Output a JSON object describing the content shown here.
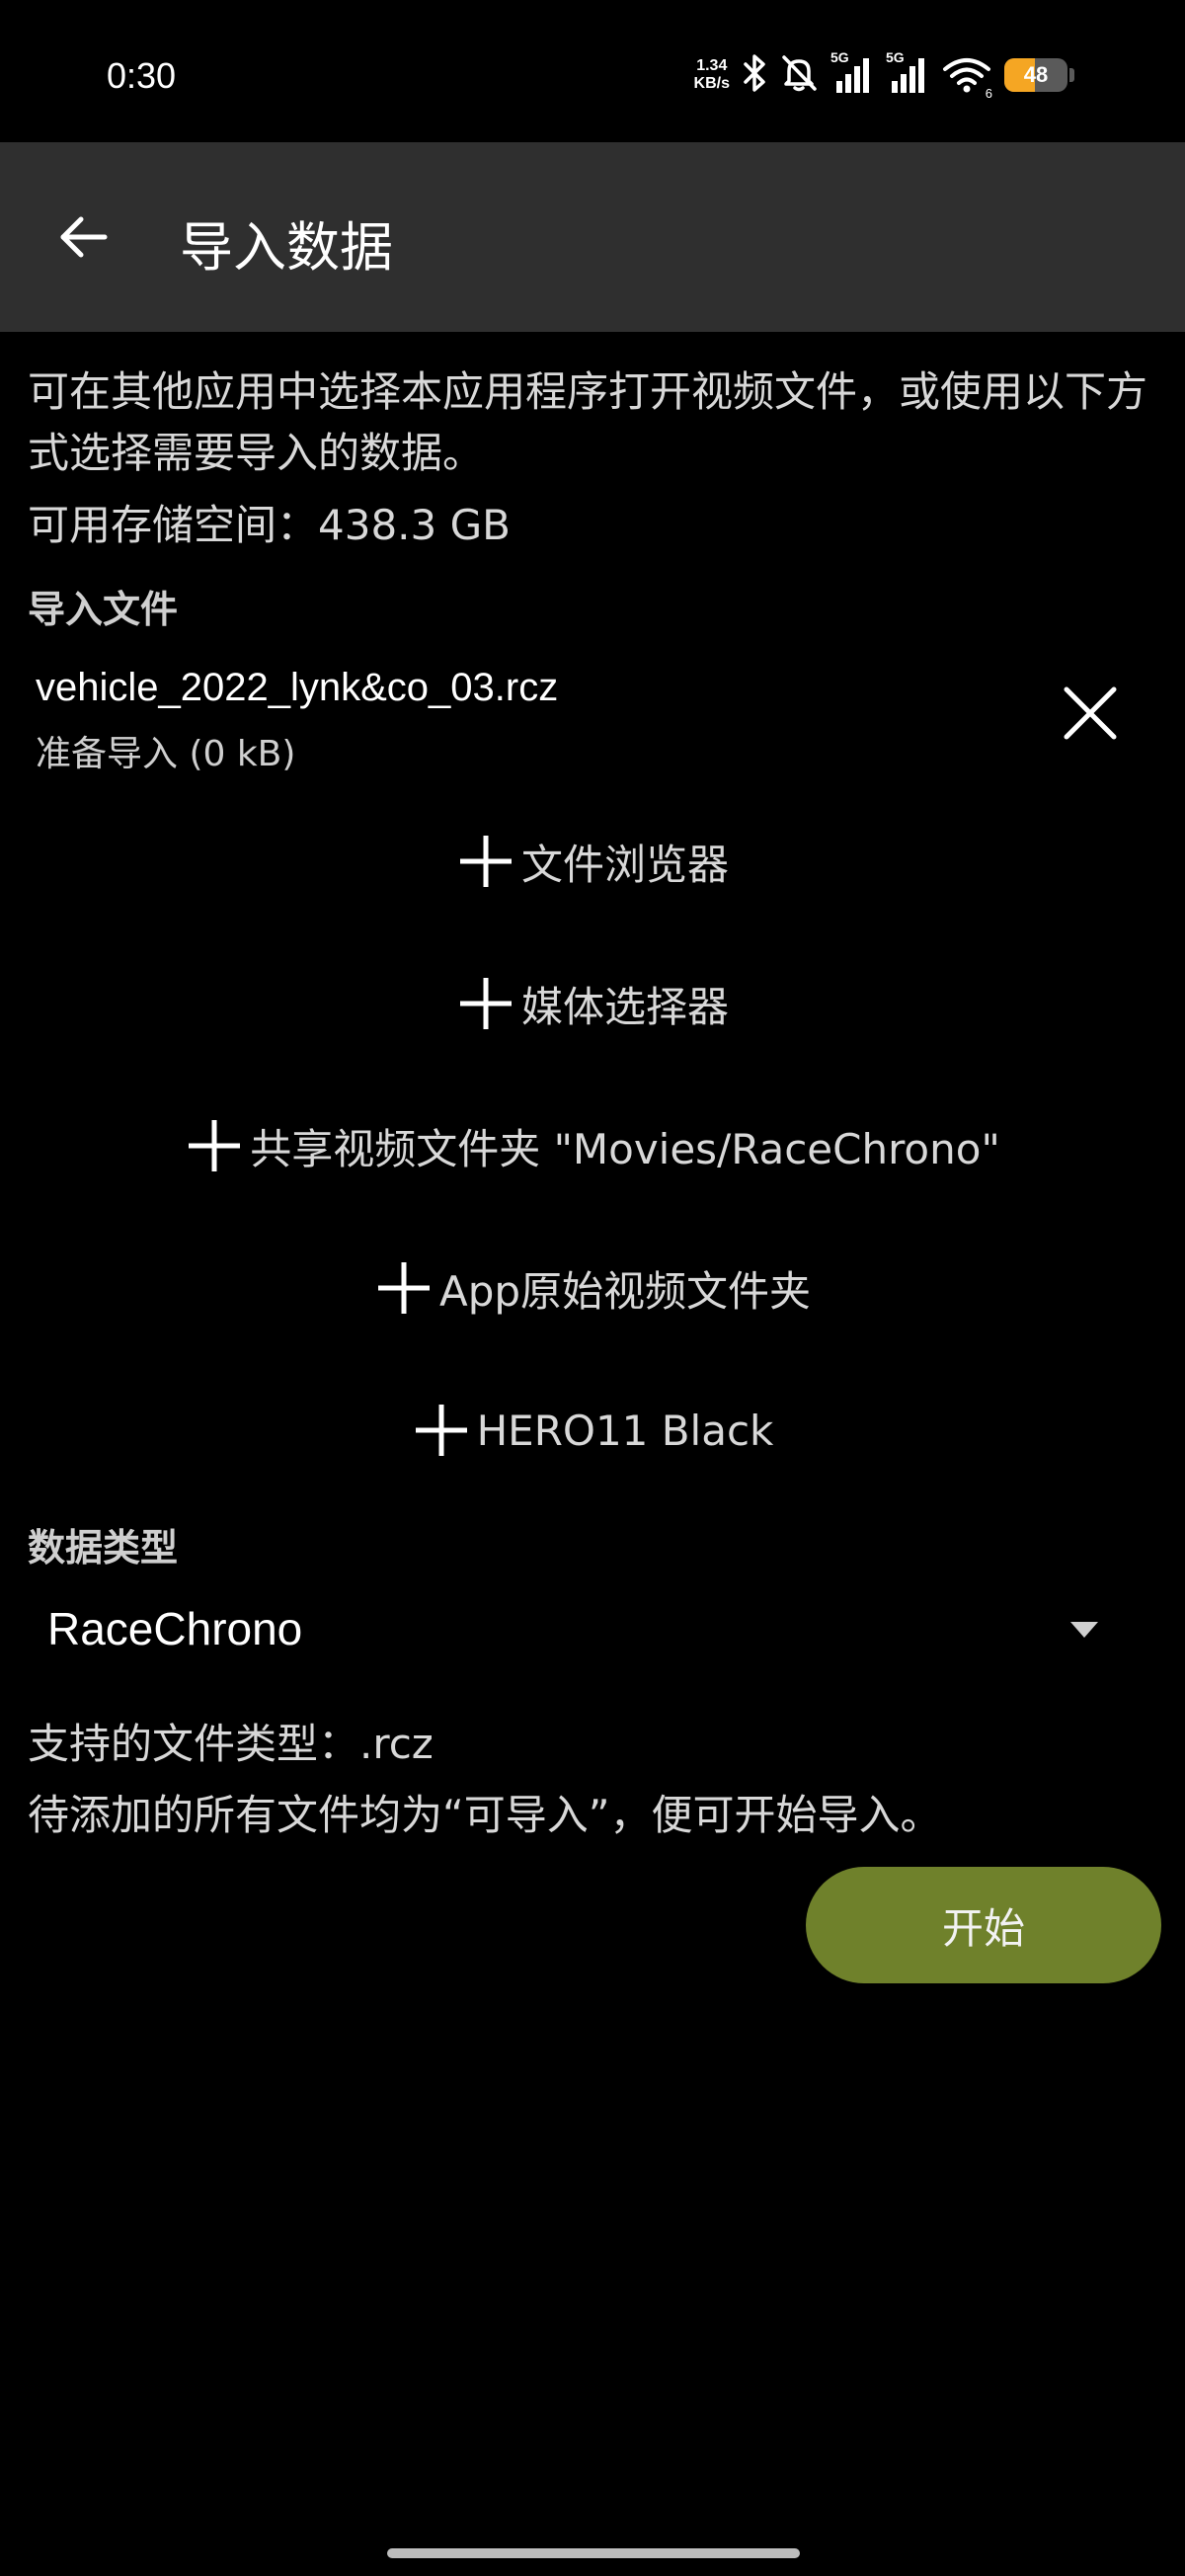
{
  "status_bar": {
    "time": "0:30",
    "net_speed_value": "1.34",
    "net_speed_unit": "KB/s",
    "signal_1_label": "5G",
    "signal_2_label": "5G",
    "wifi_label": "6",
    "battery_level": "48",
    "battery_fraction": 0.48,
    "battery_color": "#f5a623",
    "icons": [
      "bluetooth-icon",
      "mute-icon",
      "signal-icon",
      "signal-icon",
      "wifi-icon",
      "battery-icon"
    ]
  },
  "app_bar": {
    "title": "导入数据",
    "back_icon": "arrow-left-icon"
  },
  "content": {
    "intro_text": "可在其他应用中选择本应用程序打开视频文件，或使用以下方式选择需要导入的数据。",
    "storage_text": "可用存储空间：438.3 GB",
    "import_files_header": "导入文件",
    "files": [
      {
        "name": "vehicle_2022_lynk&co_03.rcz",
        "status": "准备导入 (0 kB)"
      }
    ],
    "add_sources": [
      {
        "label": "文件浏览器"
      },
      {
        "label": "媒体选择器"
      },
      {
        "label": "共享视频文件夹 \"Movies/RaceChrono\""
      },
      {
        "label": "App原始视频文件夹"
      },
      {
        "label": "HERO11 Black"
      }
    ],
    "data_type_header": "数据类型",
    "data_type_selected": "RaceChrono",
    "supported_types": "支持的文件类型：.rcz",
    "hint_text": "待添加的所有文件均为“可导入”，便可开始导入。",
    "start_label": "开始"
  },
  "colors": {
    "app_bar_bg": "#2f2f2f",
    "background": "#000000",
    "start_button": "#6f812b"
  }
}
